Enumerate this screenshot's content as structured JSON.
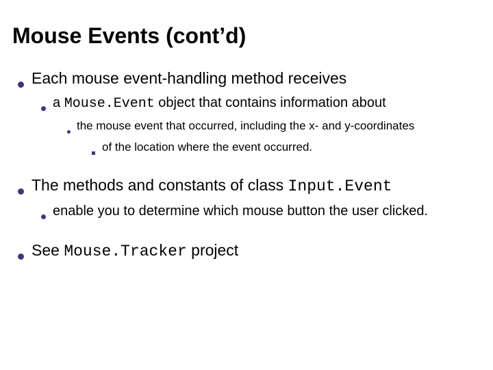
{
  "slide": {
    "title": "Mouse Events (cont’d)",
    "section1": {
      "text": "Each mouse event-handling method receives",
      "sub1_pre": "a ",
      "sub1_code": "Mouse.Event",
      "sub1_post": " object that contains information about",
      "sub2": "the mouse event that occurred, including the x- and y-coordinates",
      "sub3": "of the location where the event occurred."
    },
    "section2": {
      "text_pre": "The methods and constants of class ",
      "text_code": "Input.Event",
      "sub1": "enable you to determine which mouse button the user clicked."
    },
    "section3": {
      "text_pre": "See ",
      "text_code": "Mouse.Tracker",
      "text_post": " project"
    }
  }
}
